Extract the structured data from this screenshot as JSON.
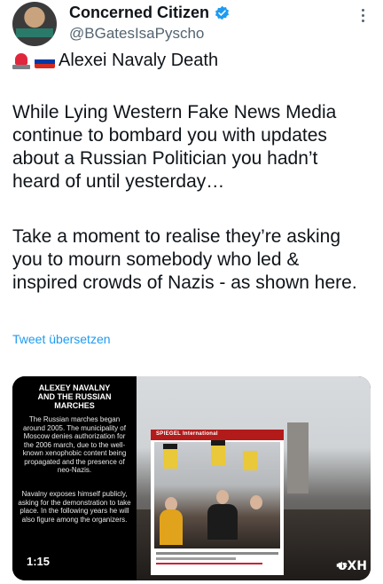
{
  "author": {
    "name": "Concerned Citizen",
    "handle": "@BGatesIsaPyscho",
    "verified_color": "#1d9bf0",
    "avatar_icon": "avatar"
  },
  "tweet": {
    "headline_emojis": [
      "siren-emoji",
      "russia-flag-emoji"
    ],
    "headline": "Alexei Navaly Death",
    "paragraph1": "While Lying Western Fake News Media continue to bombard you with updates about a Russian Politician you hadn’t heard of until yesterday…",
    "paragraph2": "Take a moment to realise they’re asking you to mourn somebody who led & inspired crowds of Nazis - as shown here.",
    "translate_label": "Tweet übersetzen"
  },
  "media": {
    "panel_title": "ALEXEY NAVALNY\nAND THE RUSSIAN MARCHES",
    "panel_text1": "The Russian marches began around 2005. The municipality of Moscow denies authorization for the 2006 march, due to the well-known xenophobic content being propagated and the presence of neo-Nazis.",
    "panel_text2": "Navalny exposes himself publicly, asking for the demonstration to take place. In the following years he will also figure among the organizers.",
    "duration": "1:15",
    "article_brand": "SPIEGEL International",
    "watermark": "ʊXH"
  },
  "colors": {
    "link": "#1d9bf0",
    "secondary_text": "#536471",
    "primary_text": "#0f1419"
  }
}
